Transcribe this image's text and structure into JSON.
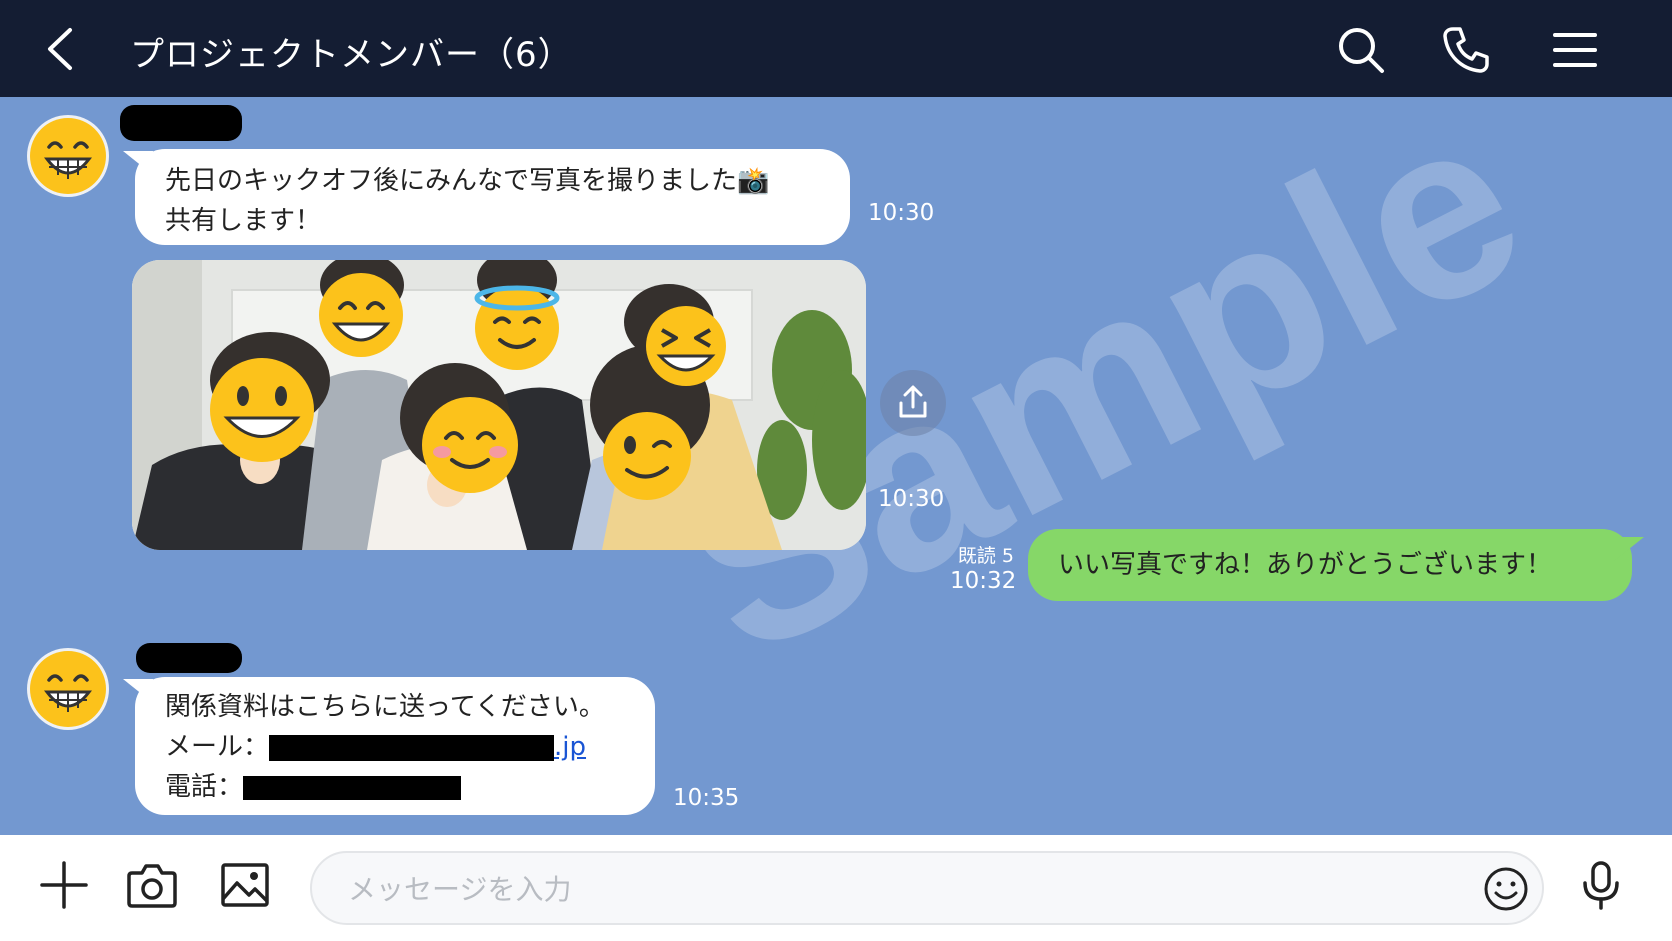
{
  "header": {
    "title": "プロジェクトメンバー（6）",
    "background": "#141d33"
  },
  "chat": {
    "background": "#7398d0",
    "watermark": "Sample",
    "messages": [
      {
        "sender": "other",
        "lines": [
          "先日のキックオフ後にみんなで写真を撮りました📸",
          "共有します！"
        ],
        "time": "10:30"
      },
      {
        "sender": "other",
        "type": "photo",
        "time": "10:30"
      },
      {
        "sender": "me",
        "text": "いい写真ですね！ありがとうございます！",
        "read_label": "既読 5",
        "time": "10:32",
        "bubble_color": "#86d768"
      },
      {
        "sender": "other",
        "line1": "関係資料はこちらに送ってください。",
        "email_label": "メール：",
        "email_suffix": ".jp",
        "phone_label": "電話：",
        "time": "10:35"
      }
    ]
  },
  "footer": {
    "input_placeholder": "メッセージを入力"
  },
  "icons": [
    "back-icon",
    "search-icon",
    "phone-icon",
    "menu-icon",
    "share-icon",
    "plus-icon",
    "camera-icon",
    "image-icon",
    "emoji-icon",
    "mic-icon"
  ]
}
